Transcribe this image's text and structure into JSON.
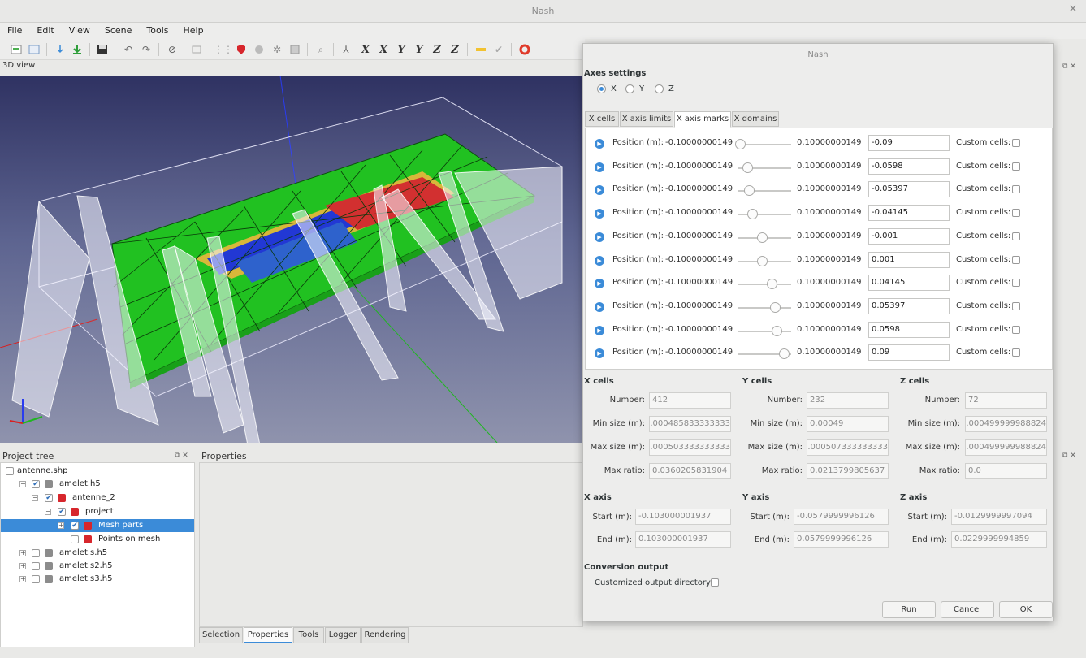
{
  "window": {
    "title": "Nash"
  },
  "menu": [
    "File",
    "Edit",
    "View",
    "Scene",
    "Tools",
    "Help"
  ],
  "toolbar_icons": [
    "new-icon",
    "open-icon",
    "import-icon",
    "download-icon",
    "save-icon",
    "undo-icon",
    "redo-icon",
    "stop-icon",
    "frame-icon",
    "grid-icon",
    "shield-icon",
    "sphere-icon",
    "settings-icon",
    "mesh-icon",
    "zoom-icon",
    "axes-icon"
  ],
  "axis_buttons": [
    "X",
    "X",
    "Y",
    "Y",
    "Z",
    "Z"
  ],
  "view": {
    "label": "3D view"
  },
  "project_tree": {
    "title": "Project tree",
    "items": [
      {
        "label": "antenne.shp"
      },
      {
        "label": "amelet.h5"
      },
      {
        "label": "antenne_2"
      },
      {
        "label": "project"
      },
      {
        "label": "Mesh parts"
      },
      {
        "label": "Points on mesh"
      },
      {
        "label": "amelet.s.h5"
      },
      {
        "label": "amelet.s2.h5"
      },
      {
        "label": "amelet.s3.h5"
      }
    ]
  },
  "properties": {
    "title": "Properties"
  },
  "bottom_tabs": [
    "Selection",
    "Properties",
    "Tools",
    "Logger",
    "Rendering"
  ],
  "dialog": {
    "title": "Nash",
    "axes_settings_label": "Axes settings",
    "axes": [
      "X",
      "Y",
      "Z"
    ],
    "selected_axis": "X",
    "tabs": [
      "X cells",
      "X axis limits",
      "X axis marks",
      "X domains"
    ],
    "active_tab": "X axis marks",
    "marks": {
      "position_label": "Position (m):",
      "min": "-0.10000000149",
      "max": "0.10000000149",
      "custom_label": "Custom cells:",
      "values": [
        "-0.09",
        "-0.0598",
        "-0.05397",
        "-0.04145",
        "-0.001",
        "0.001",
        "0.04145",
        "0.05397",
        "0.0598",
        "0.09"
      ]
    },
    "cells": [
      {
        "title": "X cells",
        "number": "412",
        "min_size": "0.000485833333333",
        "max_size": "0.000503333333333",
        "max_ratio": "0.0360205831904"
      },
      {
        "title": "Y cells",
        "number": "232",
        "min_size": "0.00049",
        "max_size": "0.000507333333333",
        "max_ratio": "0.0213799805637"
      },
      {
        "title": "Z cells",
        "number": "72",
        "min_size": "0.000499999988824",
        "max_size": "0.000499999988824",
        "max_ratio": "0.0"
      }
    ],
    "cell_labels": {
      "number": "Number:",
      "min_size": "Min size (m):",
      "max_size": "Max size (m):",
      "max_ratio": "Max ratio:"
    },
    "axis_limits": [
      {
        "title": "X axis",
        "start": "-0.103000001937",
        "end": "0.103000001937"
      },
      {
        "title": "Y axis",
        "start": "-0.0579999996126",
        "end": "0.0579999996126"
      },
      {
        "title": "Z axis",
        "start": "-0.0129999997094",
        "end": "0.0229999994859"
      }
    ],
    "axis_labels": {
      "start": "Start (m):",
      "end": "End (m):"
    },
    "conversion_output_label": "Conversion output",
    "customized_output_label": "Customized output directory:",
    "buttons": {
      "run": "Run",
      "cancel": "Cancel",
      "ok": "OK"
    }
  }
}
